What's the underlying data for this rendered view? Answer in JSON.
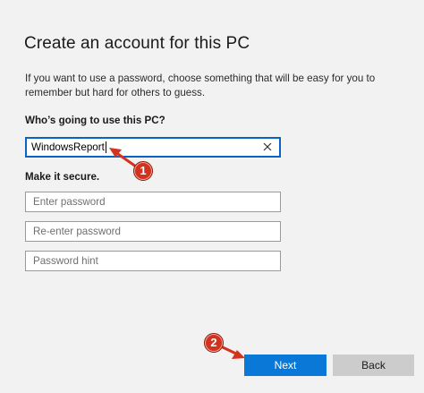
{
  "page": {
    "title": "Create an account for this PC",
    "description": "If you want to use a password, choose something that will be easy for you to remember but hard for others to guess."
  },
  "form": {
    "who_label": "Who’s going to use this PC?",
    "username_value": "WindowsReport",
    "secure_label": "Make it secure.",
    "password_placeholder": "Enter password",
    "reenter_placeholder": "Re-enter password",
    "hint_placeholder": "Password hint"
  },
  "buttons": {
    "next_label": "Next",
    "back_label": "Back"
  },
  "annotations": {
    "step1": "1",
    "step2": "2"
  },
  "colors": {
    "accent": "#0a78d7",
    "focus_border": "#0a64c8",
    "annotation": "#d2321e",
    "background": "#f2f2f2"
  },
  "icons": {
    "clear": "close-icon"
  }
}
